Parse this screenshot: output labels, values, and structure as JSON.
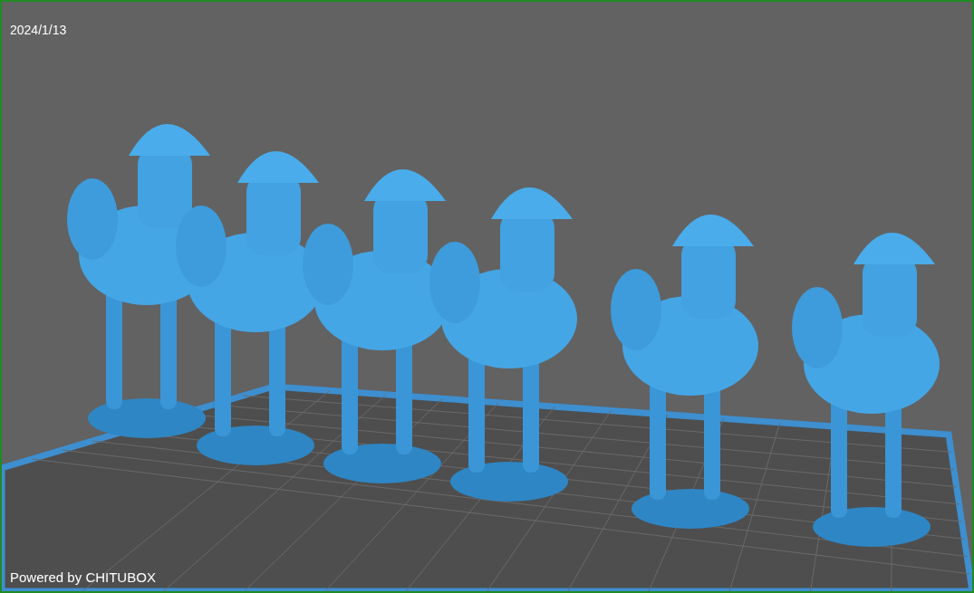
{
  "viewport": {
    "date": "2024/1/13",
    "footer": "Powered by CHITUBOX"
  }
}
